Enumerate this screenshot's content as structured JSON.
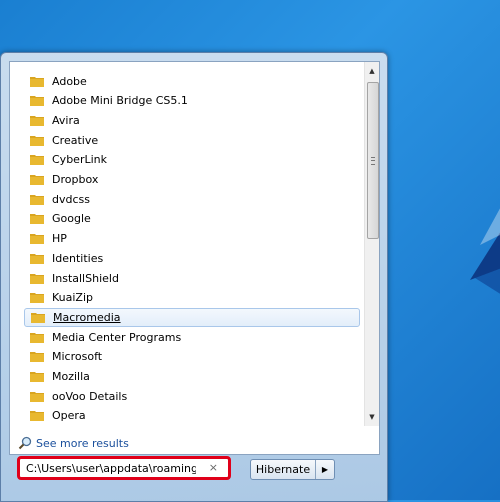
{
  "programs": {
    "items": [
      {
        "label": "Adobe"
      },
      {
        "label": "Adobe Mini Bridge CS5.1"
      },
      {
        "label": "Avira"
      },
      {
        "label": "Creative"
      },
      {
        "label": "CyberLink"
      },
      {
        "label": "Dropbox"
      },
      {
        "label": "dvdcss"
      },
      {
        "label": "Google"
      },
      {
        "label": "HP"
      },
      {
        "label": "Identities"
      },
      {
        "label": "InstallShield"
      },
      {
        "label": "KuaiZip"
      },
      {
        "label": "Macromedia"
      },
      {
        "label": "Media Center Programs"
      },
      {
        "label": "Microsoft"
      },
      {
        "label": "Mozilla"
      },
      {
        "label": "ooVoo Details"
      },
      {
        "label": "Opera"
      }
    ],
    "selected_label": "Macromedia"
  },
  "see_more": {
    "label": "See more results"
  },
  "search": {
    "value": "C:\\Users\\user\\appdata\\roaming\\",
    "clear_glyph": "×"
  },
  "shutdown": {
    "label": "Hibernate",
    "arrow_glyph": "▶"
  },
  "scroll": {
    "up_glyph": "▲",
    "down_glyph": "▼"
  },
  "colors": {
    "highlight_border": "#e0001a",
    "folder": "#e8b830",
    "link": "#1a4f9c"
  }
}
